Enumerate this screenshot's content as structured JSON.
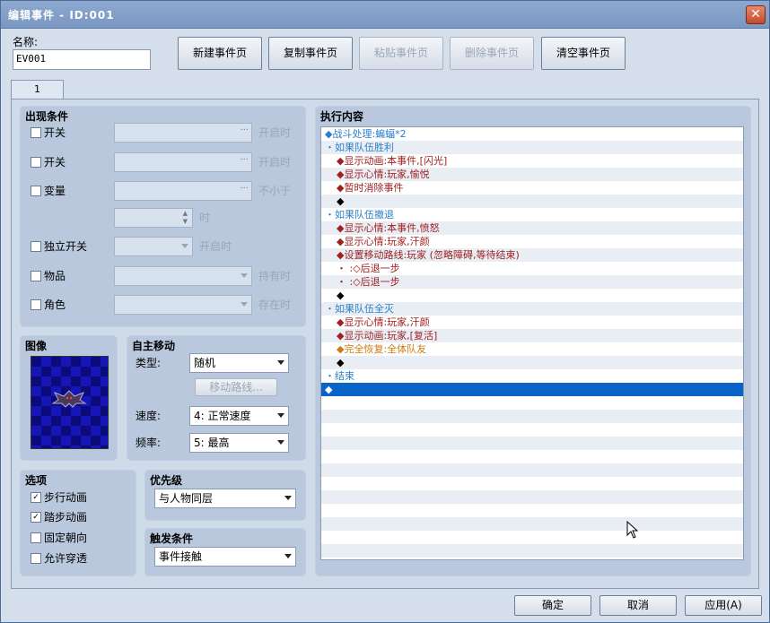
{
  "window": {
    "title": "编辑事件 - ID:001"
  },
  "name": {
    "label": "名称:",
    "value": "EV001"
  },
  "toolbar": [
    {
      "label": "新建事件页",
      "enabled": true
    },
    {
      "label": "复制事件页",
      "enabled": true
    },
    {
      "label": "粘贴事件页",
      "enabled": false
    },
    {
      "label": "删除事件页",
      "enabled": false
    },
    {
      "label": "清空事件页",
      "enabled": true
    }
  ],
  "tab": {
    "label": "1"
  },
  "conditions": {
    "title": "出现条件",
    "switch1": {
      "label": "开关",
      "suffix": "开启时"
    },
    "switch2": {
      "label": "开关",
      "suffix": "开启时"
    },
    "variable": {
      "label": "变量",
      "suffix": "不小于",
      "unit": "时"
    },
    "self_switch": {
      "label": "独立开关",
      "suffix": "开启时"
    },
    "item": {
      "label": "物品",
      "suffix": "持有时"
    },
    "actor": {
      "label": "角色",
      "suffix": "存在时"
    }
  },
  "image": {
    "title": "图像"
  },
  "autonomous": {
    "title": "自主移动",
    "type_label": "类型:",
    "type_value": "随机",
    "route_button": "移动路线...",
    "speed_label": "速度:",
    "speed_value": "4: 正常速度",
    "freq_label": "频率:",
    "freq_value": "5: 最高"
  },
  "options": {
    "title": "选项",
    "items": [
      {
        "label": "步行动画",
        "checked": true
      },
      {
        "label": "踏步动画",
        "checked": true
      },
      {
        "label": "固定朝向",
        "checked": false
      },
      {
        "label": "允许穿透",
        "checked": false
      }
    ]
  },
  "priority": {
    "title": "优先级",
    "value": "与人物同层"
  },
  "trigger": {
    "title": "触发条件",
    "value": "事件接触"
  },
  "contents": {
    "title": "执行内容",
    "lines": [
      {
        "text": "◆战斗处理:蝙蝠*2",
        "indent": 0,
        "color": "blue"
      },
      {
        "text": "・如果队伍胜利",
        "indent": 0,
        "color": "blue"
      },
      {
        "text": "◆显示动画:本事件,[闪光]",
        "indent": 1,
        "color": "red"
      },
      {
        "text": "◆显示心情:玩家,愉悦",
        "indent": 1,
        "color": "red"
      },
      {
        "text": "◆暂时消除事件",
        "indent": 1,
        "color": "red"
      },
      {
        "text": "◆",
        "indent": 1,
        "color": "dark"
      },
      {
        "text": "・如果队伍撤退",
        "indent": 0,
        "color": "blue"
      },
      {
        "text": "◆显示心情:本事件,愤怒",
        "indent": 1,
        "color": "red"
      },
      {
        "text": "◆显示心情:玩家,汗颜",
        "indent": 1,
        "color": "red"
      },
      {
        "text": "◆设置移动路线:玩家 (忽略障碍,等待结束)",
        "indent": 1,
        "color": "red"
      },
      {
        "text": "・                  :◇后退一步",
        "indent": 1,
        "color": "red"
      },
      {
        "text": "・                  :◇后退一步",
        "indent": 1,
        "color": "red"
      },
      {
        "text": "◆",
        "indent": 1,
        "color": "dark"
      },
      {
        "text": "・如果队伍全灭",
        "indent": 0,
        "color": "blue"
      },
      {
        "text": "◆显示心情:玩家,汗颜",
        "indent": 1,
        "color": "red"
      },
      {
        "text": "◆显示动画:玩家,[复活]",
        "indent": 1,
        "color": "red"
      },
      {
        "text": "◆完全恢复:全体队友",
        "indent": 1,
        "color": "orange"
      },
      {
        "text": "◆",
        "indent": 1,
        "color": "dark"
      },
      {
        "text": "・结束",
        "indent": 0,
        "color": "blue"
      },
      {
        "text": "◆",
        "indent": 0,
        "color": "selected"
      }
    ]
  },
  "footer": {
    "ok": "确定",
    "cancel": "取消",
    "apply": "应用(A)"
  }
}
